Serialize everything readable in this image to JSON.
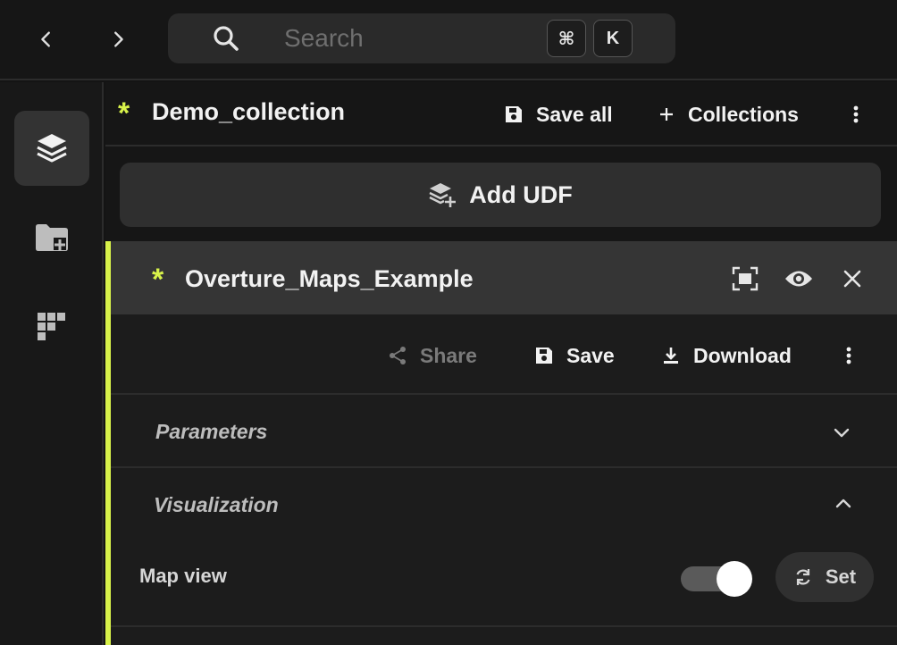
{
  "nav": {
    "back_icon": "chevron-left-icon",
    "forward_icon": "chevron-right-icon"
  },
  "search": {
    "placeholder": "Search",
    "shortcut_keys": [
      "⌘",
      "K"
    ]
  },
  "rail": {
    "items": [
      "layers-icon",
      "folder-add-icon",
      "grid-blocks-icon"
    ],
    "active": "layers-icon"
  },
  "collection": {
    "modified_marker": "*",
    "name": "Demo_collection",
    "save_all_label": "Save all",
    "collections_label": "Collections"
  },
  "add_udf": {
    "label": "Add UDF"
  },
  "udf": {
    "modified_marker": "*",
    "name": "Overture_Maps_Example",
    "actions": {
      "share": "Share",
      "save": "Save",
      "download": "Download"
    },
    "sections": {
      "parameters": {
        "title": "Parameters",
        "expanded": false
      },
      "visualization": {
        "title": "Visualization",
        "expanded": true
      }
    },
    "map_view": {
      "label": "Map view",
      "toggle_on": true,
      "set_label": "Set"
    }
  },
  "colors": {
    "accent": "#d8f24a",
    "background": "#161616",
    "panel": "#353535"
  }
}
